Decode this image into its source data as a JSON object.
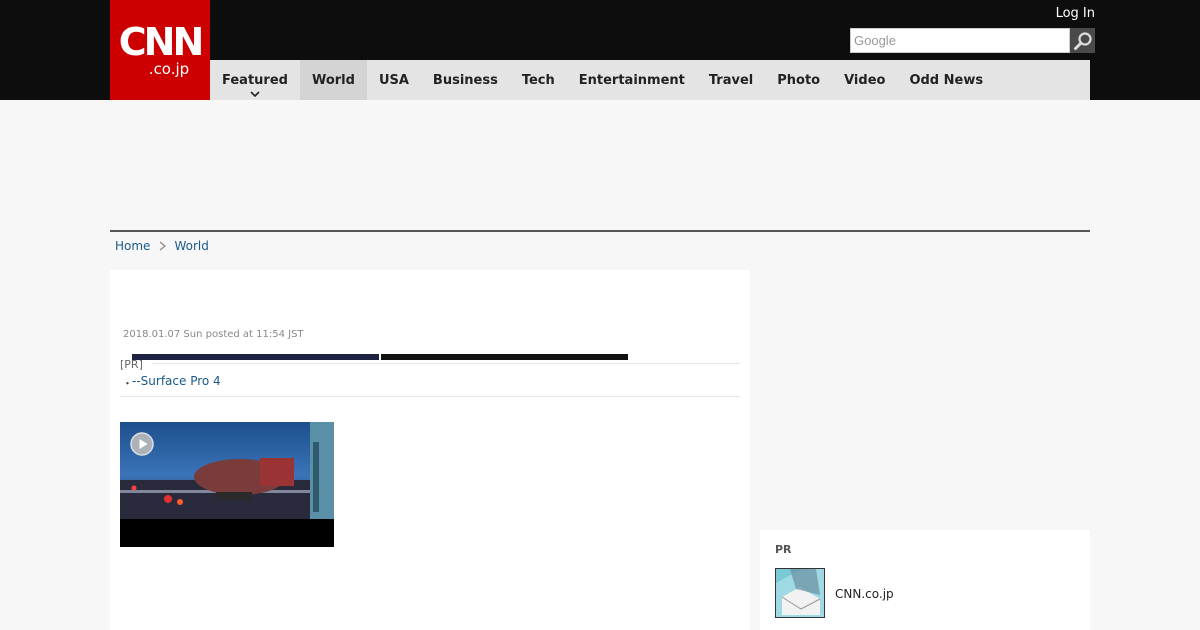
{
  "header": {
    "logo_main": "CNN",
    "logo_sub": ".co.jp",
    "login_label": "Log In",
    "search_placeholder": "Google"
  },
  "nav": {
    "items": [
      {
        "label": "Featured"
      },
      {
        "label": "World"
      },
      {
        "label": "USA"
      },
      {
        "label": "Business"
      },
      {
        "label": "Tech"
      },
      {
        "label": "Entertainment"
      },
      {
        "label": "Travel"
      },
      {
        "label": "Photo"
      },
      {
        "label": "Video"
      },
      {
        "label": "Odd News"
      }
    ]
  },
  "breadcrumb": {
    "home": "Home",
    "current": "World"
  },
  "article": {
    "date": "2018.01.07 Sun posted at 11:54 JST",
    "pr_label": "[PR]",
    "pr_bullet": "・",
    "pr_link": "--Surface Pro 4"
  },
  "sidebar": {
    "pr_label": "PR",
    "pr_item": "CNN.co.jp"
  },
  "icons": {
    "search": "search-icon",
    "breadcrumb_separator": "chevron-right-icon",
    "nav_dropdown": "chevron-down-icon",
    "video_play": "play-icon"
  },
  "colors": {
    "brand_red": "#cc0000",
    "header_bg": "#0d0d0d",
    "nav_bg": "#e4e4e4",
    "link": "#1a5a8a"
  }
}
